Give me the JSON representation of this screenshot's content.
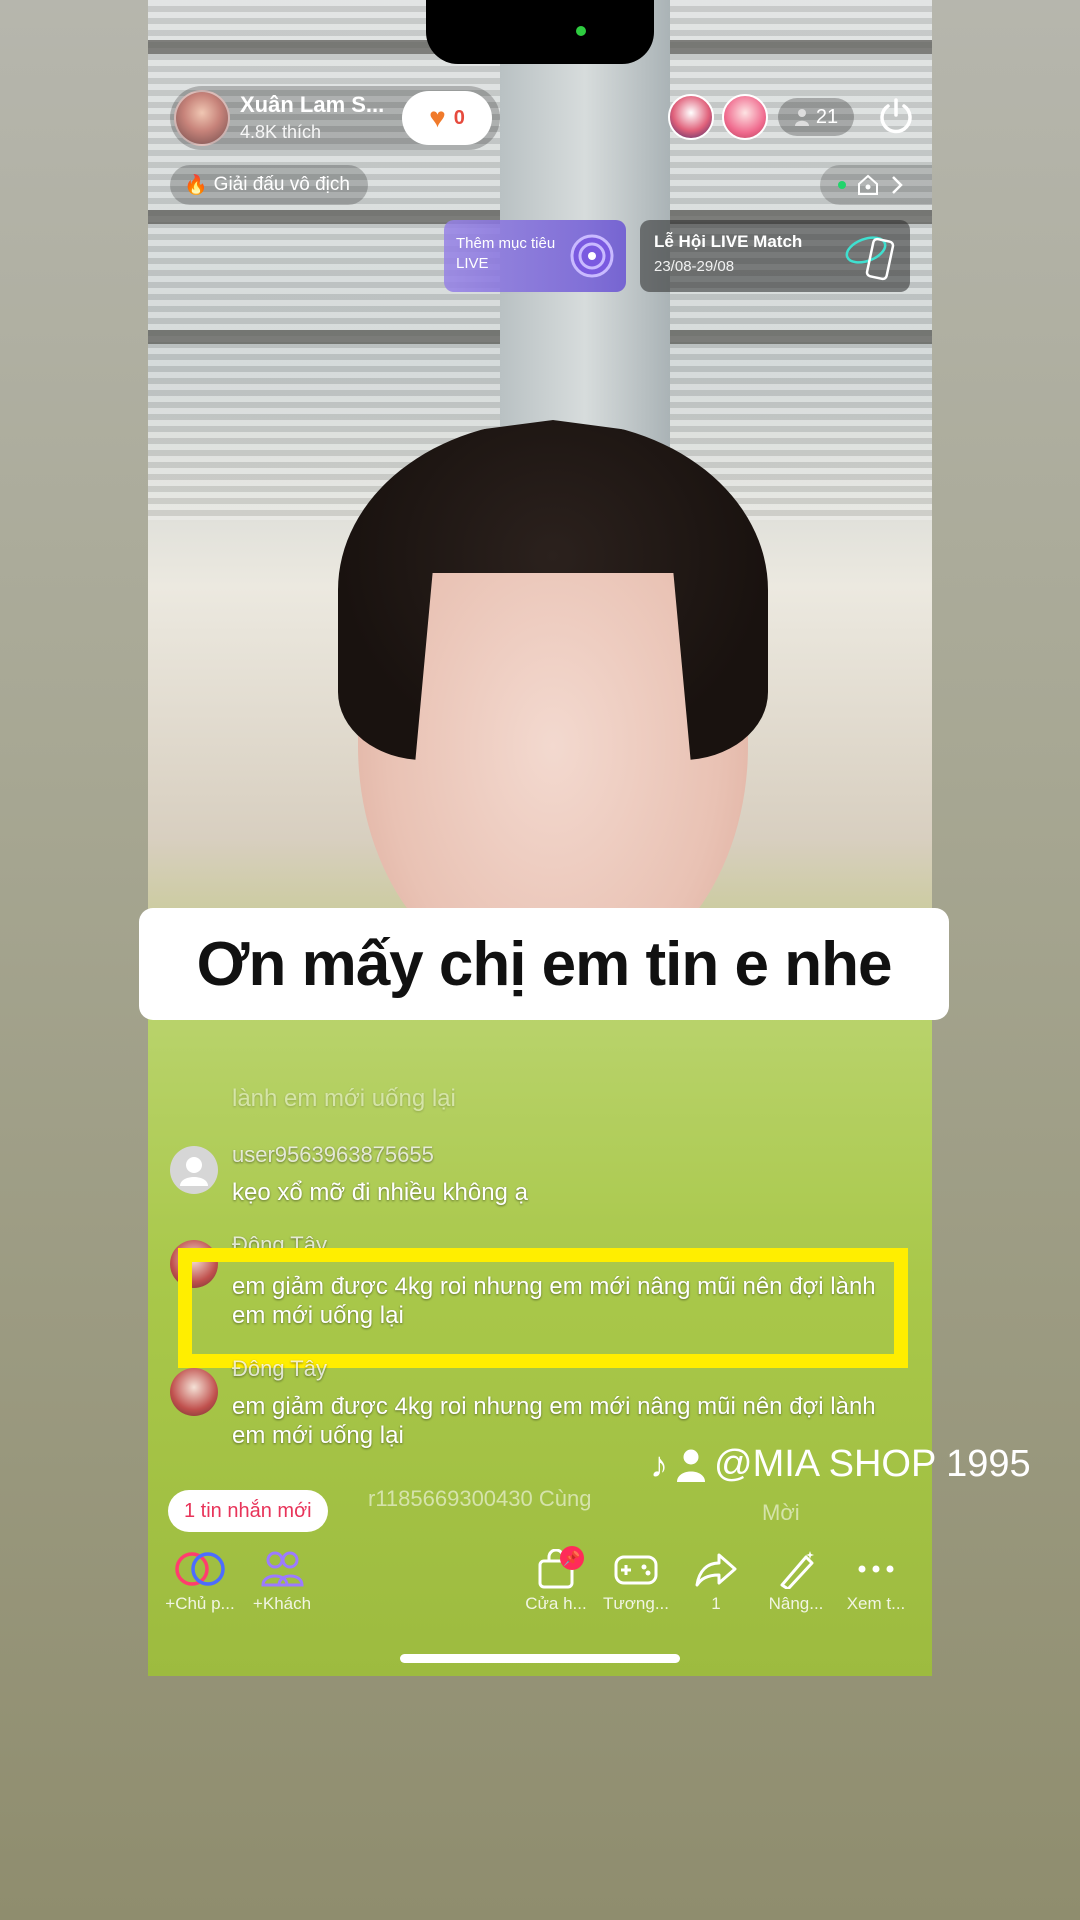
{
  "host": {
    "name": "Xuân Lam S...",
    "likes": "4.8K thích"
  },
  "follow": {
    "count": "0"
  },
  "viewers": {
    "count": "21"
  },
  "tournament": {
    "label": "Giải đấu vô địch"
  },
  "goal_card": {
    "text": "Thêm mục tiêu LIVE"
  },
  "match_card": {
    "title": "Lễ Hội LIVE Match",
    "dates": "23/08-29/08"
  },
  "caption": "Ơn mấy chị em tin e nhe",
  "chat": {
    "faded_top": "lành em mới uống lại",
    "messages": [
      {
        "name": "user9563963875655",
        "text": "kẹo xổ mỡ đi nhiều không ạ"
      },
      {
        "name": "Đông Tây",
        "text": "em giảm được 4kg roi nhưng em mới nâng mũi nên đợi lành em mới uống lại"
      },
      {
        "name": "Đông Tây",
        "text": "em giảm được 4kg roi nhưng em mới nâng mũi nên đợi lành em mới uống lại"
      }
    ],
    "faded_bottom": "r1185669300430 Cùng",
    "invite": "Mời"
  },
  "new_message_button": "1 tin nhắn mới",
  "watermark": {
    "handle": "@MIA SHOP 1995"
  },
  "toolbar": {
    "cohost": "+Chủ p...",
    "guest": "+Khách",
    "shop": "Cửa h...",
    "interact": "Tương...",
    "share_count": "1",
    "enhance": "Nâng...",
    "more": "Xem t..."
  },
  "colors": {
    "highlight": "#ffee00",
    "accent": "#ff2b59",
    "follow_heart": "#f07a2b"
  }
}
